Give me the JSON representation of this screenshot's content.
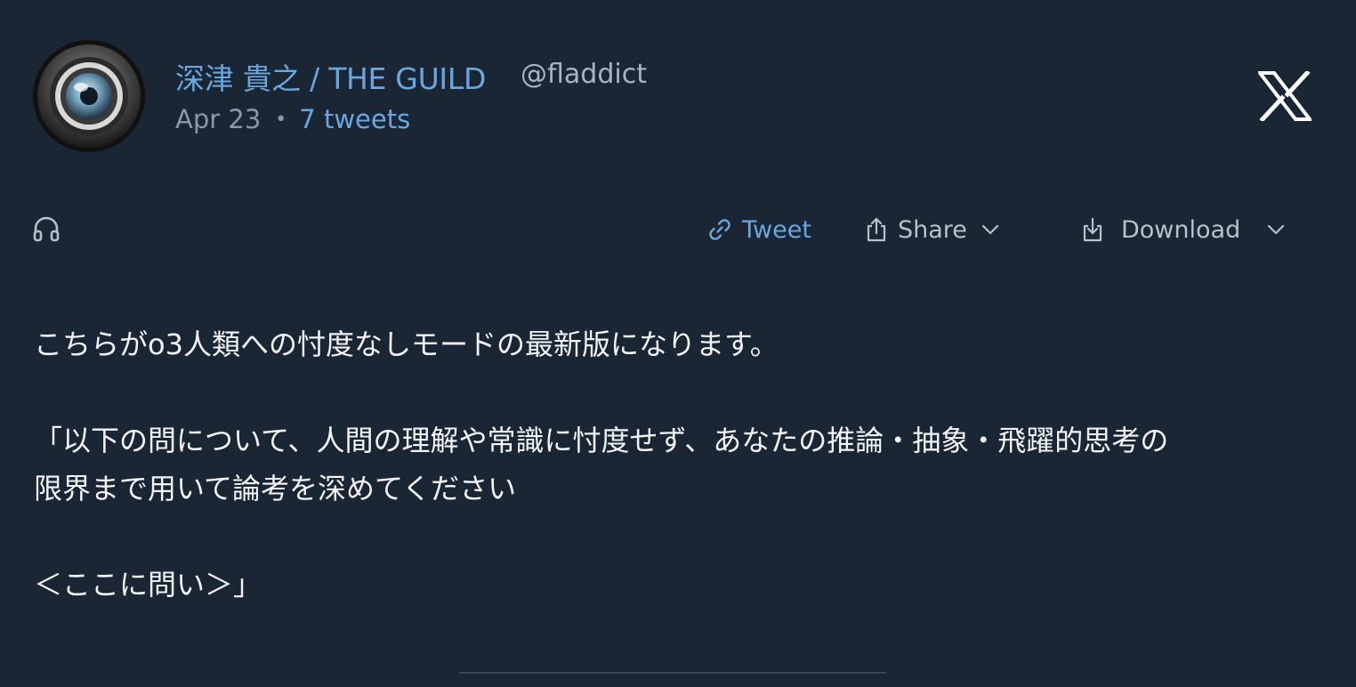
{
  "author": {
    "name": "深津 貴之 / THE GUILD",
    "handle": "@fladdict",
    "date": "Apr 23",
    "separator": "•",
    "tweet_count": "7 tweets"
  },
  "actions": {
    "tweet_label": "Tweet",
    "share_label": "Share",
    "download_label": "Download"
  },
  "tweet": {
    "lines": [
      "こちらがo3人類への忖度なしモードの最新版になります。",
      "",
      "「以下の問について、人間の理解や常識に忖度せず、あなたの推論・抽象・飛躍的思考の",
      "限界まで用いて論考を深めてください",
      "",
      "＜ここに問い＞」"
    ]
  },
  "icons": {
    "avatar": "camera-lens-avatar",
    "platform": "x-logo-icon",
    "listen": "headphones-icon",
    "tweet": "link-icon",
    "share": "share-icon",
    "download": "download-icon",
    "dropdown": "chevron-down-icon"
  },
  "colors": {
    "background": "#1b2635",
    "accent": "#6aa7df",
    "muted": "#8c97a5",
    "text": "#f2f4f7"
  }
}
